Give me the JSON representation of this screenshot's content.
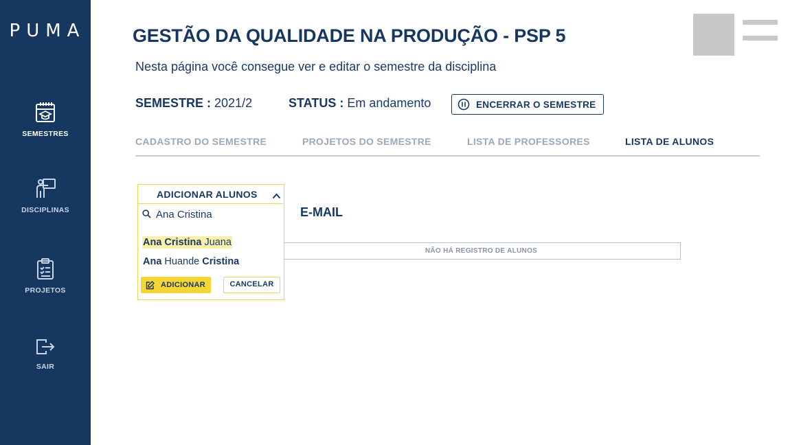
{
  "sidebar": {
    "logo": "PUMA",
    "items": [
      {
        "label": "SEMESTRES",
        "icon": "calendar-graduation-icon"
      },
      {
        "label": "DISCIPLINAS",
        "icon": "teacher-board-icon"
      },
      {
        "label": "PROJETOS",
        "icon": "clipboard-list-icon"
      },
      {
        "label": "SAIR",
        "icon": "logout-icon"
      }
    ]
  },
  "header": {
    "title": "GESTÃO DA QUALIDADE NA PRODUÇÃO - PSP 5",
    "subtitle": "Nesta página você consegue ver e editar o semestre da disciplina"
  },
  "info": {
    "semester_label": "SEMESTRE :",
    "semester_value": "2021/2",
    "status_label": "STATUS :",
    "status_value": "Em andamento",
    "end_button": "ENCERRAR O SEMESTRE"
  },
  "tabs": [
    {
      "label": "CADASTRO DO SEMESTRE",
      "active": false
    },
    {
      "label": "PROJETOS DO SEMESTRE",
      "active": false
    },
    {
      "label": "LISTA DE PROFESSORES",
      "active": false
    },
    {
      "label": "LISTA DE ALUNOS",
      "active": true
    }
  ],
  "table": {
    "email_header": "E-MAIL",
    "empty_message": "NÃO HÁ REGISTRO DE ALUNOS"
  },
  "dropdown": {
    "header": "ADICIONAR ALUNOS",
    "search_value": "Ana Cristina",
    "options": [
      {
        "bold": "Ana Cristina",
        "rest": " Juana",
        "selected": true
      },
      {
        "bold_first": "Ana",
        "middle": " Huande ",
        "bold_last": "Cristina",
        "selected": false
      }
    ],
    "add_button": "ADICIONAR",
    "cancel_button": "CANCELAR"
  },
  "colors": {
    "sidebar_bg": "#16375f",
    "accent_yellow": "#f6d534",
    "text_primary": "#16375f",
    "tab_inactive": "#9aa8bb"
  }
}
